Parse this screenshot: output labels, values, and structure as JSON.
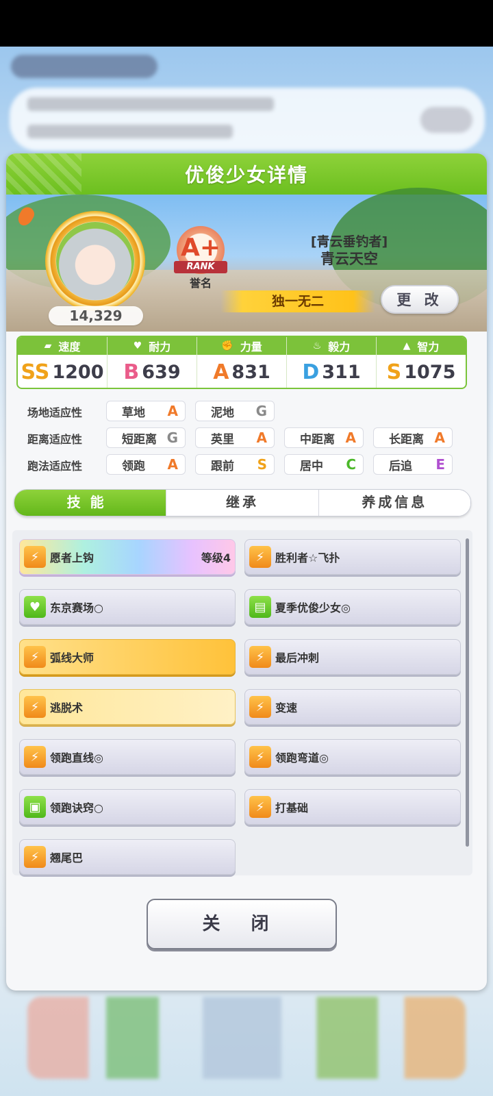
{
  "panel": {
    "title": "优俊少女详情"
  },
  "profile": {
    "fans": "14,329",
    "rank_grade": "A+",
    "rank_word": "RANK",
    "rank_label": "誉名",
    "title_bracket": "[青云垂钓者]",
    "name": "青云天空",
    "unique_title": "独一无二",
    "change_button": "更 改"
  },
  "stats": [
    {
      "label": "速度",
      "icon": "shoe-icon",
      "grade": "SS",
      "grade_color": "#f0a21a",
      "value": "1200"
    },
    {
      "label": "耐力",
      "icon": "heart-icon",
      "grade": "B",
      "grade_color": "#ea5c8a",
      "value": "639"
    },
    {
      "label": "力量",
      "icon": "muscle-icon",
      "grade": "A",
      "grade_color": "#f07a2a",
      "value": "831"
    },
    {
      "label": "毅力",
      "icon": "flame-icon",
      "grade": "D",
      "grade_color": "#3aa0e0",
      "value": "311"
    },
    {
      "label": "智力",
      "icon": "graduation-cap-icon",
      "grade": "S",
      "grade_color": "#f0a21a",
      "value": "1075"
    }
  ],
  "aptitude": {
    "field": {
      "label": "场地适应性",
      "items": [
        {
          "name": "草地",
          "grade": "A"
        },
        {
          "name": "泥地",
          "grade": "G"
        }
      ]
    },
    "distance": {
      "label": "距离适应性",
      "items": [
        {
          "name": "短距离",
          "grade": "G"
        },
        {
          "name": "英里",
          "grade": "A"
        },
        {
          "name": "中距离",
          "grade": "A"
        },
        {
          "name": "长距离",
          "grade": "A"
        }
      ]
    },
    "style": {
      "label": "跑法适应性",
      "items": [
        {
          "name": "领跑",
          "grade": "A"
        },
        {
          "name": "跟前",
          "grade": "S"
        },
        {
          "name": "居中",
          "grade": "C"
        },
        {
          "name": "后追",
          "grade": "E"
        }
      ]
    },
    "grade_colors": {
      "A": "#f07a2a",
      "G": "#8a8a8a",
      "S": "#f0a21a",
      "C": "#4cb82a",
      "E": "#b050d0"
    }
  },
  "tabs": [
    "技能",
    "继承",
    "养成信息"
  ],
  "skills": [
    {
      "name": "愿者上钩",
      "level": "等级4",
      "style": "rainbow",
      "icon": "runner-icon"
    },
    {
      "name": "胜利者☆飞扑",
      "level": "",
      "style": "gray",
      "icon": "runner-icon"
    },
    {
      "name": "东京赛场○",
      "level": "",
      "style": "gray",
      "icon": "heart-icon"
    },
    {
      "name": "夏季优俊少女◎",
      "level": "",
      "style": "gray",
      "icon": "card-icon"
    },
    {
      "name": "弧线大师",
      "level": "",
      "style": "gold",
      "icon": "runner-icon"
    },
    {
      "name": "最后冲刺",
      "level": "",
      "style": "gray",
      "icon": "runner-icon"
    },
    {
      "name": "逃脱术",
      "level": "",
      "style": "gold-light",
      "icon": "runner-icon"
    },
    {
      "name": "变速",
      "level": "",
      "style": "gray",
      "icon": "runner-icon"
    },
    {
      "name": "领跑直线◎",
      "level": "",
      "style": "gray",
      "icon": "runner-icon"
    },
    {
      "name": "领跑弯道◎",
      "level": "",
      "style": "gray",
      "icon": "runner-icon"
    },
    {
      "name": "领跑诀窍○",
      "level": "",
      "style": "gray",
      "icon": "book-icon"
    },
    {
      "name": "打基础",
      "level": "",
      "style": "gray",
      "icon": "runner-icon"
    },
    {
      "name": "翘尾巴",
      "level": "",
      "style": "gray",
      "icon": "runner-icon"
    }
  ],
  "close_button": "关 闭",
  "colors": {
    "accent_green": "#7cc23a"
  }
}
